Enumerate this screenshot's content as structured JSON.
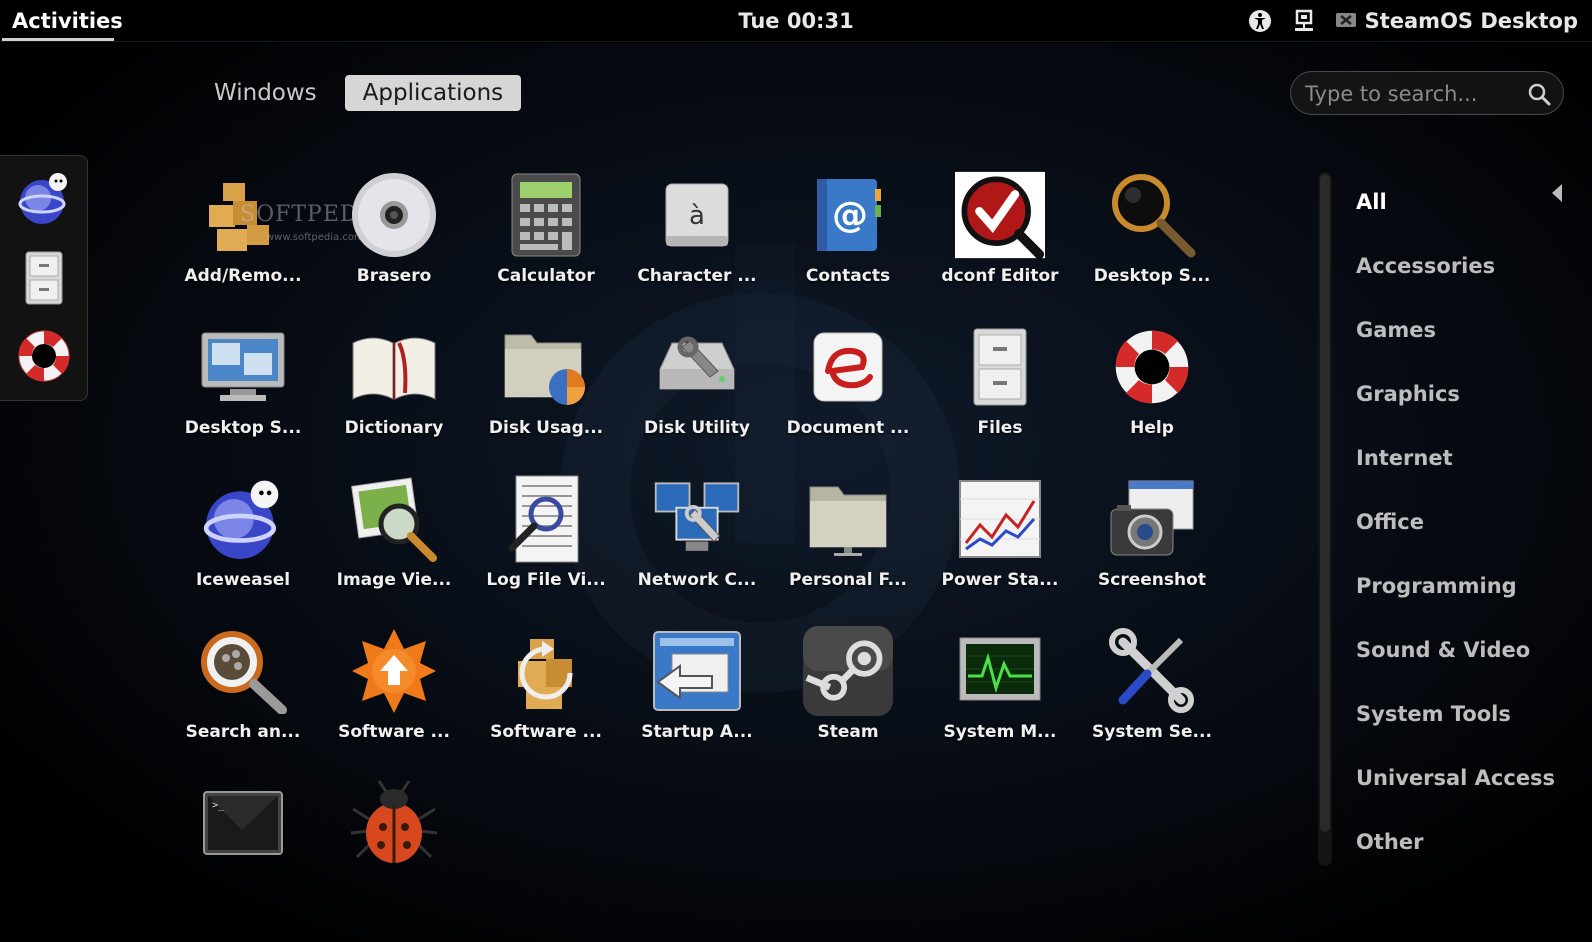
{
  "topbar": {
    "activities_label": "Activities",
    "clock": "Tue 00:31",
    "user_label": "SteamOS Desktop",
    "tray_icons": [
      "accessibility-icon",
      "network-icon",
      "user-icon"
    ]
  },
  "view_tabs": {
    "windows_label": "Windows",
    "applications_label": "Applications",
    "active": "Applications"
  },
  "search": {
    "placeholder": "Type to search..."
  },
  "dash": {
    "items": [
      "iceweasel",
      "files",
      "help"
    ]
  },
  "watermark": {
    "brand": "SOFTPEDIA",
    "url": "www.softpedia.com"
  },
  "apps": [
    {
      "label": "Add/Remo...",
      "icon": "package-icon"
    },
    {
      "label": "Brasero",
      "icon": "disc-icon"
    },
    {
      "label": "Calculator",
      "icon": "calculator-icon"
    },
    {
      "label": "Character ...",
      "icon": "character-map-icon"
    },
    {
      "label": "Contacts",
      "icon": "contacts-icon"
    },
    {
      "label": "dconf Editor",
      "icon": "dconf-icon"
    },
    {
      "label": "Desktop S...",
      "icon": "magnifier-icon"
    },
    {
      "label": "Desktop S...",
      "icon": "monitor-icon"
    },
    {
      "label": "Dictionary",
      "icon": "book-icon"
    },
    {
      "label": "Disk Usag...",
      "icon": "disk-usage-icon"
    },
    {
      "label": "Disk Utility",
      "icon": "disk-utility-icon"
    },
    {
      "label": "Document ...",
      "icon": "document-viewer-icon"
    },
    {
      "label": "Files",
      "icon": "file-cabinet-icon"
    },
    {
      "label": "Help",
      "icon": "lifebuoy-icon"
    },
    {
      "label": "Iceweasel",
      "icon": "iceweasel-icon"
    },
    {
      "label": "Image Vie...",
      "icon": "image-viewer-icon"
    },
    {
      "label": "Log File Vi...",
      "icon": "log-viewer-icon"
    },
    {
      "label": "Network C...",
      "icon": "network-tools-icon"
    },
    {
      "label": "Personal F...",
      "icon": "folder-icon"
    },
    {
      "label": "Power Sta...",
      "icon": "power-stats-icon"
    },
    {
      "label": "Screenshot",
      "icon": "camera-icon"
    },
    {
      "label": "Search an...",
      "icon": "search-files-icon"
    },
    {
      "label": "Software ...",
      "icon": "software-update-icon"
    },
    {
      "label": "Software ...",
      "icon": "software-installer-icon"
    },
    {
      "label": "Startup A...",
      "icon": "startup-apps-icon"
    },
    {
      "label": "Steam",
      "icon": "steam-icon"
    },
    {
      "label": "System M...",
      "icon": "system-monitor-icon"
    },
    {
      "label": "System Se...",
      "icon": "system-settings-icon"
    },
    {
      "label": "",
      "icon": "terminal-icon"
    },
    {
      "label": "",
      "icon": "bug-icon"
    }
  ],
  "categories": [
    "All",
    "Accessories",
    "Games",
    "Graphics",
    "Internet",
    "Office",
    "Programming",
    "Sound & Video",
    "System Tools",
    "Universal Access",
    "Other"
  ],
  "active_category": "All",
  "colors": {
    "topbar_bg": "#000000",
    "tab_active_bg": "#d6d6d6",
    "category_active": "#ffffff",
    "category_inactive": "#bdbdbd"
  }
}
